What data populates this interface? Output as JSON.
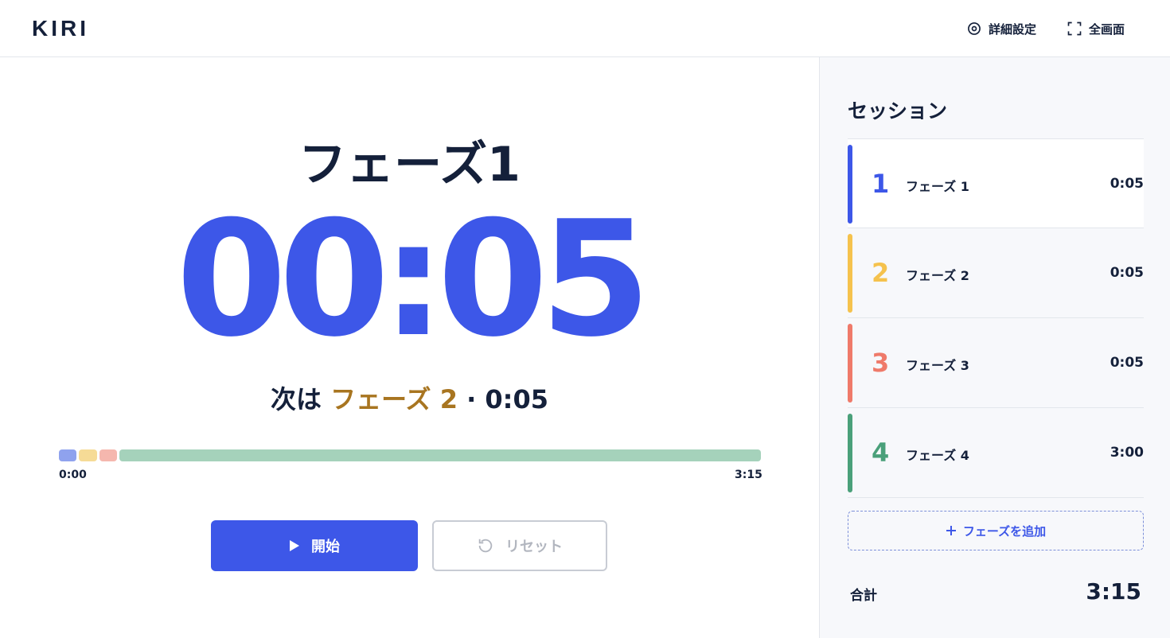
{
  "app": {
    "logo": "KIRI"
  },
  "header": {
    "settings_label": "詳細設定",
    "fullscreen_label": "全画面"
  },
  "main": {
    "phase_title": "フェーズ1",
    "timer": "00:05",
    "next_prefix": "次は",
    "next_name": "フェーズ 2",
    "next_sep": "·",
    "next_time": "0:05",
    "progress": {
      "start_label": "0:00",
      "end_label": "3:15",
      "segments": [
        {
          "seconds": 5,
          "color": "#8fa2ee"
        },
        {
          "seconds": 5,
          "color": "#f6db96"
        },
        {
          "seconds": 5,
          "color": "#f5b7ae"
        },
        {
          "seconds": 180,
          "color": "#a5d2bb"
        }
      ]
    },
    "start_label": "開始",
    "reset_label": "リセット"
  },
  "sidebar": {
    "title": "セッション",
    "phases": [
      {
        "num": "1",
        "name": "フェーズ 1",
        "duration": "0:05",
        "color": "#3d57e8",
        "active": true
      },
      {
        "num": "2",
        "name": "フェーズ 2",
        "duration": "0:05",
        "color": "#f5c24d",
        "active": false
      },
      {
        "num": "3",
        "name": "フェーズ 3",
        "duration": "0:05",
        "color": "#ef7a6a",
        "active": false
      },
      {
        "num": "4",
        "name": "フェーズ 4",
        "duration": "3:00",
        "color": "#4aa07a",
        "active": false
      }
    ],
    "add_label": "フェーズを追加",
    "total_label": "合計",
    "total_value": "3:15"
  },
  "icons": [
    "gear-icon",
    "fullscreen-icon",
    "play-icon",
    "reset-icon",
    "plus-icon"
  ]
}
